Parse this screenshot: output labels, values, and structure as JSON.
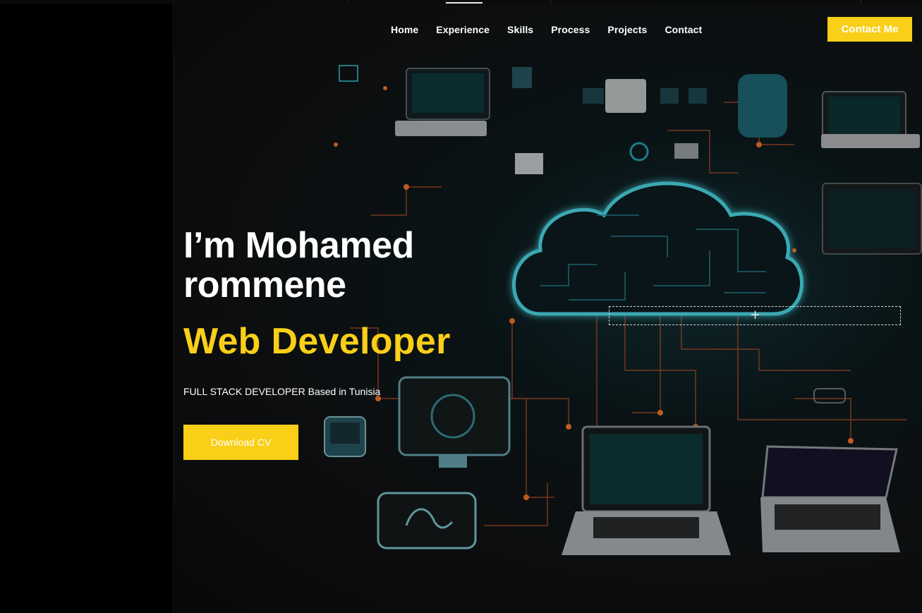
{
  "nav": {
    "items": [
      {
        "label": "Home"
      },
      {
        "label": "Experience"
      },
      {
        "label": "Skills"
      },
      {
        "label": "Process"
      },
      {
        "label": "Projects"
      },
      {
        "label": "Contact"
      }
    ],
    "contact_button": "Contact Me"
  },
  "hero": {
    "title": "I’m Mohamed rommene",
    "subtitle": "Web Developer",
    "tagline": "FULL STACK DEVELOPER Based in Tunisia",
    "download_button": "Download CV"
  },
  "colors": {
    "accent": "#f9cf18",
    "background": "#111214",
    "glow": "#3fd6e6",
    "wire": "#e0642a"
  },
  "icons": [
    "cloud-circuit-illustration",
    "plus-icon"
  ]
}
